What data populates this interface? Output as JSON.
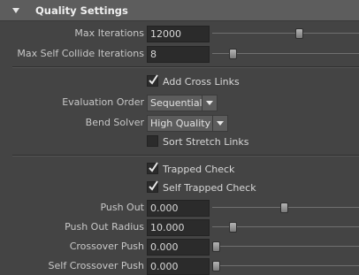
{
  "section": {
    "title": "Quality Settings"
  },
  "fields": {
    "max_iterations": {
      "label": "Max Iterations",
      "value": "12000",
      "slider_fraction": 0.6
    },
    "max_self_collide_iterations": {
      "label": "Max Self Collide Iterations",
      "value": "8",
      "slider_fraction": 0.12
    },
    "push_out": {
      "label": "Push Out",
      "value": "0.000",
      "slider_fraction": 0.49
    },
    "push_out_radius": {
      "label": "Push Out Radius",
      "value": "10.000",
      "slider_fraction": 0.12
    },
    "crossover_push": {
      "label": "Crossover Push",
      "value": "0.000",
      "slider_fraction": 0.0
    },
    "self_crossover_push": {
      "label": "Self Crossover Push",
      "value": "0.000",
      "slider_fraction": 0.0
    }
  },
  "checkboxes": {
    "add_cross_links": {
      "label": "Add Cross Links",
      "checked": true
    },
    "sort_stretch_links": {
      "label": "Sort Stretch Links",
      "checked": false
    },
    "trapped_check": {
      "label": "Trapped Check",
      "checked": true
    },
    "self_trapped_check": {
      "label": "Self Trapped Check",
      "checked": true
    }
  },
  "dropdowns": {
    "evaluation_order": {
      "label": "Evaluation Order",
      "value": "Sequential"
    },
    "bend_solver": {
      "label": "Bend Solver",
      "value": "High Quality"
    }
  },
  "colors": {
    "background": "#444444",
    "header": "#5d5d5d",
    "field": "#2b2b2b",
    "text": "#c8c8c8"
  }
}
